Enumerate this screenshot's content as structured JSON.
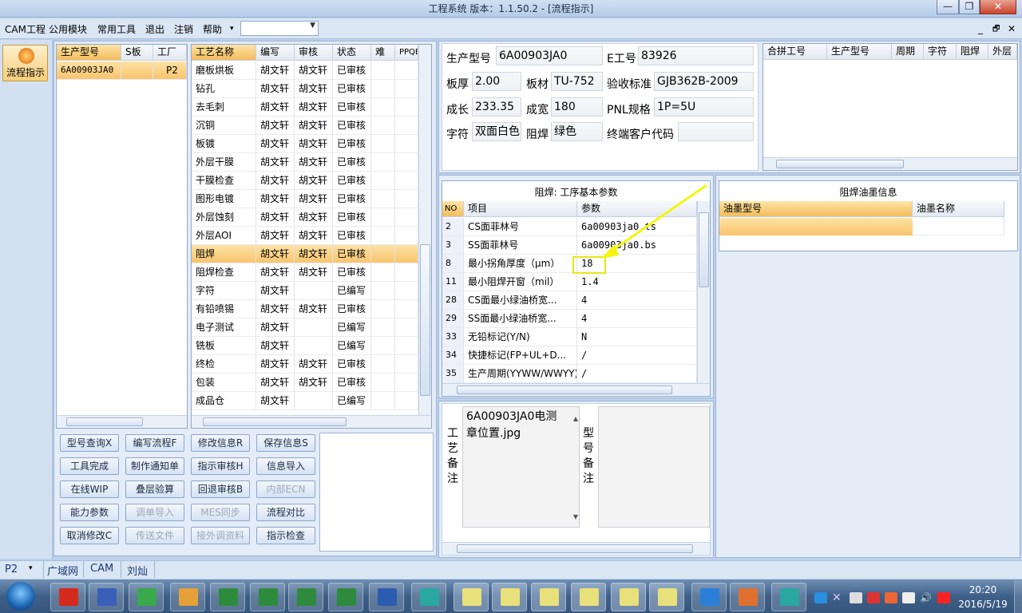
{
  "window": {
    "title": "工程系统  版本：1.1.50.2 - [流程指示]",
    "minimize": "—",
    "restore": "❐",
    "close": "✕"
  },
  "menu": {
    "items": [
      "CAM工程",
      "公用模块",
      "常用工具",
      "退出",
      "注销",
      "帮助"
    ],
    "help_arrow": "▾",
    "combo_value": "",
    "mdi_controls": [
      "_",
      "🗗",
      "✕"
    ]
  },
  "nav": {
    "button_label": "流程指示"
  },
  "model_list": {
    "headers": [
      "生产型号",
      "S板",
      "工厂"
    ],
    "rows": [
      {
        "model": "6A00903JA0",
        "s": "",
        "factory": "P2"
      }
    ]
  },
  "process_list": {
    "headers": [
      "工艺名称",
      "编写",
      "审核",
      "状态",
      "难",
      "PPQE"
    ],
    "rows": [
      {
        "name": "磨板烘板",
        "writer": "胡文轩",
        "reviewer": "胡文轩",
        "status": "已审核"
      },
      {
        "name": "钻孔",
        "writer": "胡文轩",
        "reviewer": "胡文轩",
        "status": "已审核"
      },
      {
        "name": "去毛刺",
        "writer": "胡文轩",
        "reviewer": "胡文轩",
        "status": "已审核"
      },
      {
        "name": "沉铜",
        "writer": "胡文轩",
        "reviewer": "胡文轩",
        "status": "已审核"
      },
      {
        "name": "板镀",
        "writer": "胡文轩",
        "reviewer": "胡文轩",
        "status": "已审核"
      },
      {
        "name": "外层干膜",
        "writer": "胡文轩",
        "reviewer": "胡文轩",
        "status": "已审核"
      },
      {
        "name": "干膜检查",
        "writer": "胡文轩",
        "reviewer": "胡文轩",
        "status": "已审核"
      },
      {
        "name": "图形电镀",
        "writer": "胡文轩",
        "reviewer": "胡文轩",
        "status": "已审核"
      },
      {
        "name": "外层蚀刻",
        "writer": "胡文轩",
        "reviewer": "胡文轩",
        "status": "已审核"
      },
      {
        "name": "外层AOI",
        "writer": "胡文轩",
        "reviewer": "胡文轩",
        "status": "已审核"
      },
      {
        "name": "阻焊",
        "writer": "胡文轩",
        "reviewer": "胡文轩",
        "status": "已审核"
      },
      {
        "name": "阻焊检查",
        "writer": "胡文轩",
        "reviewer": "胡文轩",
        "status": "已审核"
      },
      {
        "name": "字符",
        "writer": "胡文轩",
        "reviewer": "",
        "status": "已编写"
      },
      {
        "name": "有铅喷锡",
        "writer": "胡文轩",
        "reviewer": "胡文轩",
        "status": "已审核"
      },
      {
        "name": "电子测试",
        "writer": "胡文轩",
        "reviewer": "",
        "status": "已编写"
      },
      {
        "name": "铣板",
        "writer": "胡文轩",
        "reviewer": "",
        "status": "已编写"
      },
      {
        "name": "终检",
        "writer": "胡文轩",
        "reviewer": "胡文轩",
        "status": "已审核"
      },
      {
        "name": "包装",
        "writer": "胡文轩",
        "reviewer": "胡文轩",
        "status": "已审核"
      },
      {
        "name": "成品仓",
        "writer": "胡文轩",
        "reviewer": "",
        "status": "已编写"
      }
    ],
    "selected_index": 10
  },
  "buttons": [
    {
      "label": "型号查询X",
      "disabled": false
    },
    {
      "label": "编写流程F",
      "disabled": false
    },
    {
      "label": "修改信息R",
      "disabled": false
    },
    {
      "label": "保存信息S",
      "disabled": false
    },
    {
      "label": "工具完成",
      "disabled": false
    },
    {
      "label": "制作通知单",
      "disabled": false
    },
    {
      "label": "指示审核H",
      "disabled": false
    },
    {
      "label": "信息导入",
      "disabled": false
    },
    {
      "label": "在线WIP",
      "disabled": false
    },
    {
      "label": "叠层验算",
      "disabled": false
    },
    {
      "label": "回退审核B",
      "disabled": false
    },
    {
      "label": "内部ECN",
      "disabled": true
    },
    {
      "label": "能力参数",
      "disabled": false
    },
    {
      "label": "调单导入",
      "disabled": true
    },
    {
      "label": "MES同步",
      "disabled": true
    },
    {
      "label": "流程对比",
      "disabled": false
    },
    {
      "label": "取消修改C",
      "disabled": false
    },
    {
      "label": "传送文件",
      "disabled": true
    },
    {
      "label": "接外调资料",
      "disabled": true
    },
    {
      "label": "指示检查",
      "disabled": false
    }
  ],
  "info": {
    "model_label": "生产型号",
    "model": "6A00903JA0",
    "e_label": "E工号",
    "e_no": "83926",
    "thick_label": "板厚",
    "thick": "2.00",
    "mat_label": "板材",
    "mat": "TU-752",
    "std_label": "验收标准",
    "std": "GJB362B-2009",
    "len_label": "成长",
    "len": "233.35",
    "wid_label": "成宽",
    "wid": "180",
    "pnl_label": "PNL规格",
    "pnl": "1P=5U",
    "char_label": "字符",
    "char": "双面白色",
    "mask_label": "阻焊",
    "mask": "绿色",
    "cust_label": "终端客户代码",
    "cust": ""
  },
  "merge_table": {
    "headers": [
      "合拼工号",
      "生产型号",
      "周期",
      "字符",
      "阻焊",
      "外层"
    ]
  },
  "params": {
    "title": "阻焊: 工序基本参数",
    "headers": [
      "NO",
      "项目",
      "参数"
    ],
    "rows": [
      {
        "no": "2",
        "item": "CS面菲林号",
        "value": "6a00903ja0.ts"
      },
      {
        "no": "3",
        "item": "SS面菲林号",
        "value": "6a00903ja0.bs"
      },
      {
        "no": "8",
        "item": "最小拐角厚度（μm）",
        "value": "18"
      },
      {
        "no": "11",
        "item": "最小阻焊开窗（mil）",
        "value": "1.4"
      },
      {
        "no": "28",
        "item": "CS面最小绿油桥宽...",
        "value": "4"
      },
      {
        "no": "29",
        "item": "SS面最小绿油桥宽...",
        "value": "4"
      },
      {
        "no": "33",
        "item": "无铅标记(Y/N)",
        "value": "N"
      },
      {
        "no": "34",
        "item": "快捷标记(FP+UL+D...",
        "value": "/"
      },
      {
        "no": "35",
        "item": "生产周期(YYWW/WWYY)",
        "value": "/"
      }
    ],
    "highlight_index": 2,
    "highlight_color": "#e6e61a"
  },
  "ink": {
    "title": "阻焊油墨信息",
    "headers": [
      "油墨型号",
      "油墨名称"
    ]
  },
  "notes": {
    "process_label": "工艺备注",
    "process_text": "6A00903JA0电测章位置.jpg",
    "model_label": "型号备注",
    "model_text": ""
  },
  "statusbar": {
    "factory": "P2",
    "arrow": "▾",
    "items": [
      "广域网",
      "CAM",
      "刘灿"
    ]
  },
  "taskbar": {
    "time": "20:20",
    "date": "2016/5/19"
  }
}
